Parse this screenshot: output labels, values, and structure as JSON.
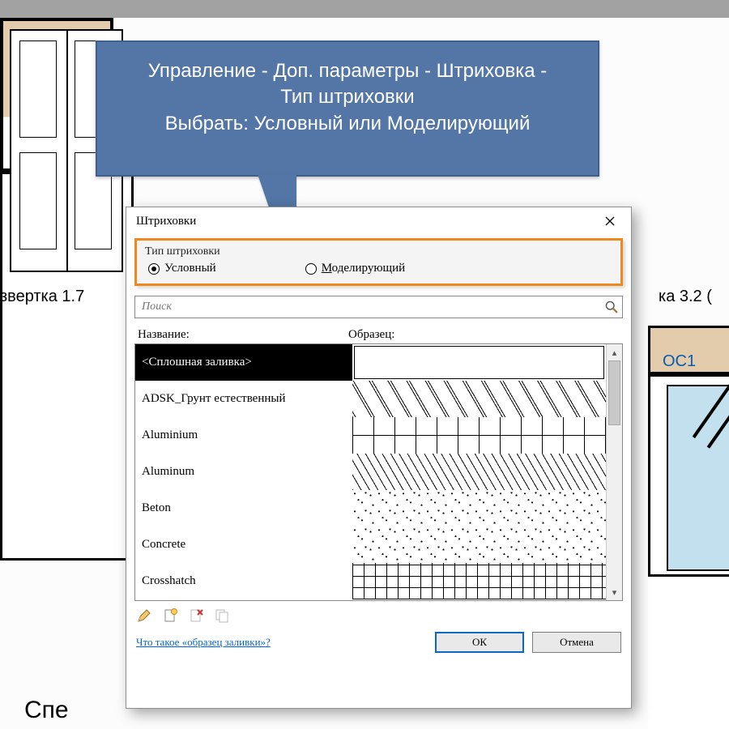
{
  "callout": {
    "line1": "Управление - Доп. параметры - Штриховка -",
    "line2": "Тип штриховки",
    "line3": "Выбрать: Условный или Моделирующий"
  },
  "bg_labels": {
    "left_scale": "звертка 1.7",
    "right_scale": "ка 3.2 (",
    "os": "OC1",
    "spec": "Спе"
  },
  "dialog": {
    "title": "Штриховки",
    "type_legend": "Тип штриховки",
    "radio1": "Условный",
    "radio2": "Моделирующий",
    "radio2_accel": "М",
    "radio2_rest": "оделирующий",
    "search_placeholder": "Поиск",
    "col_name": "Название:",
    "col_sample": "Образец:",
    "rows": [
      {
        "name": "<Сплошная заливка>",
        "swatch": "solid",
        "selected": true
      },
      {
        "name": "ADSK_Грунт естественный",
        "swatch": "diaggap",
        "selected": false
      },
      {
        "name": "Aluminium",
        "swatch": "vtick",
        "selected": false
      },
      {
        "name": "Aluminum",
        "swatch": "diag",
        "selected": false
      },
      {
        "name": "Beton",
        "swatch": "speck",
        "selected": false
      },
      {
        "name": "Concrete",
        "swatch": "speck",
        "selected": false
      },
      {
        "name": "Crosshatch",
        "swatch": "grid",
        "selected": false
      }
    ],
    "help": "Что такое «образец заливки»?",
    "ok": "ОК",
    "cancel": "Отмена"
  }
}
